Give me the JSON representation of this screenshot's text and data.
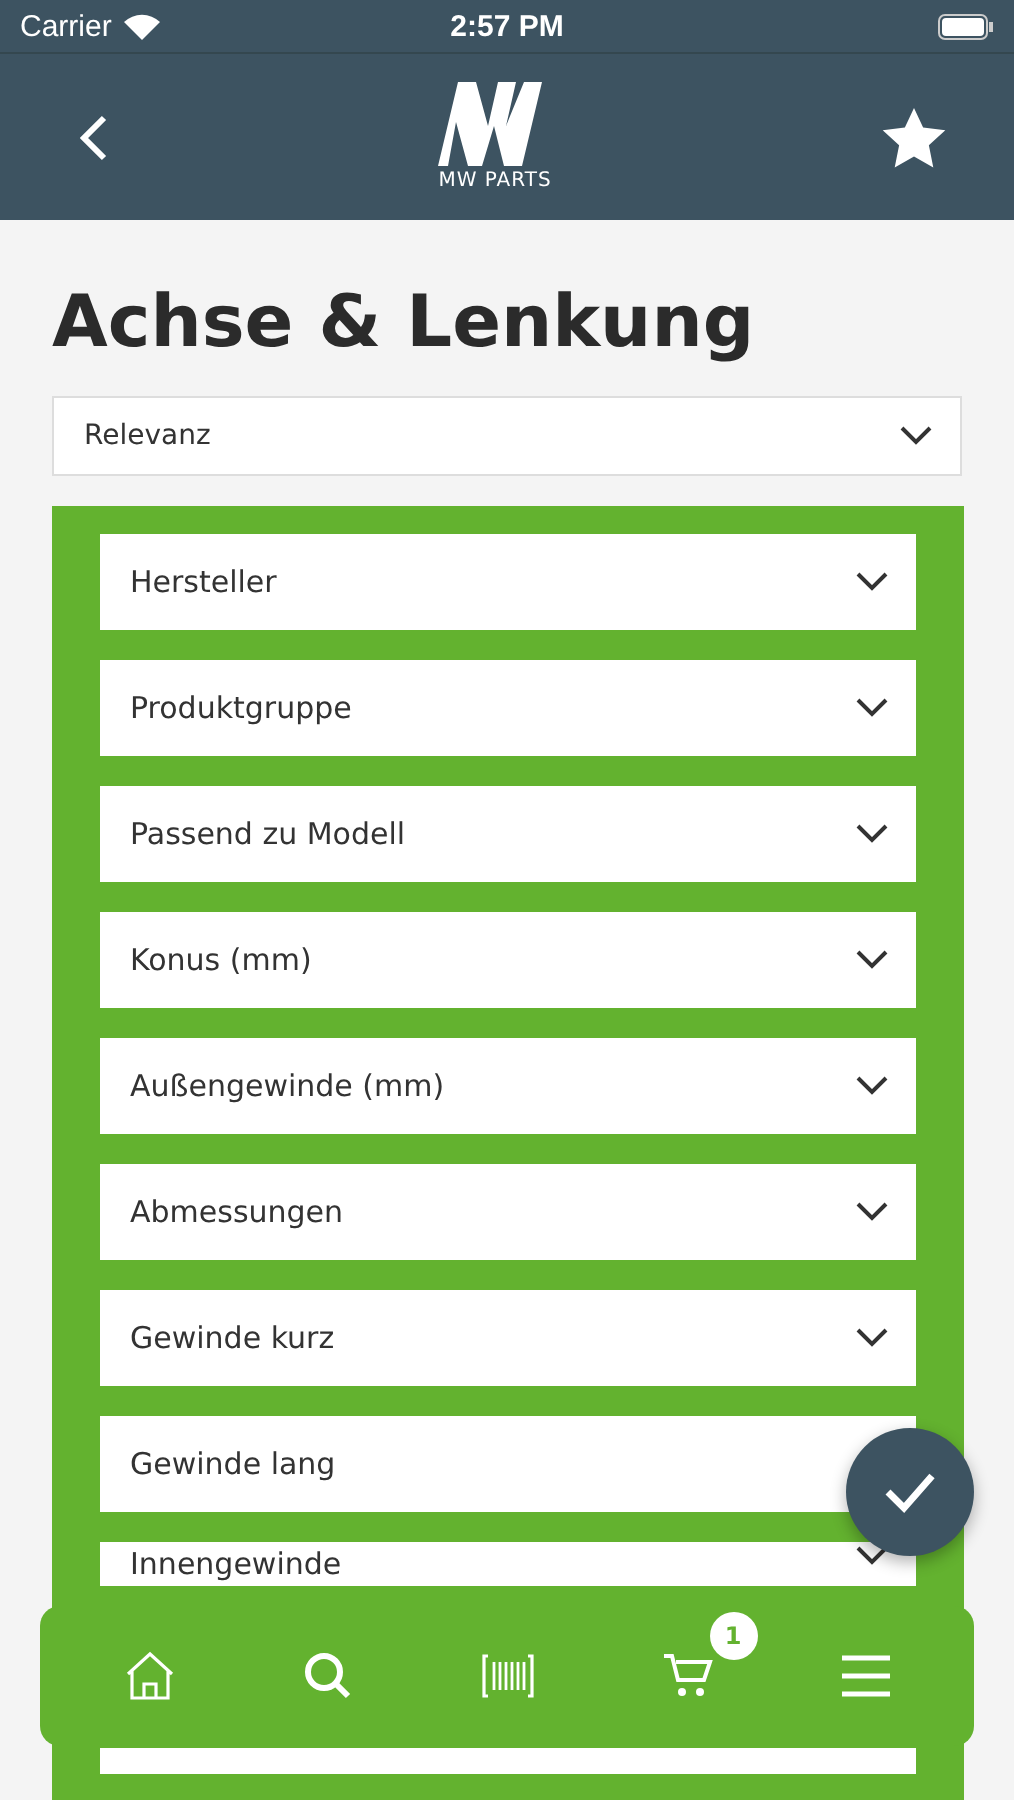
{
  "status_bar": {
    "carrier": "Carrier",
    "time": "2:57 PM"
  },
  "header": {
    "logo_text": "MW PARTS"
  },
  "title": "Achse & Lenkung",
  "sort": {
    "value": "Relevanz"
  },
  "filters": [
    {
      "label": "Hersteller"
    },
    {
      "label": "Produktgruppe"
    },
    {
      "label": "Passend zu Modell"
    },
    {
      "label": "Konus (mm)"
    },
    {
      "label": "Außengewinde (mm)"
    },
    {
      "label": "Abmessungen"
    },
    {
      "label": "Gewinde kurz"
    },
    {
      "label": "Gewinde lang"
    },
    {
      "label": "Innengewinde"
    }
  ],
  "tab_bar": {
    "items": [
      {
        "kind": "home"
      },
      {
        "kind": "search"
      },
      {
        "kind": "scan"
      },
      {
        "kind": "cart",
        "badge": "1"
      },
      {
        "kind": "menu"
      }
    ]
  }
}
